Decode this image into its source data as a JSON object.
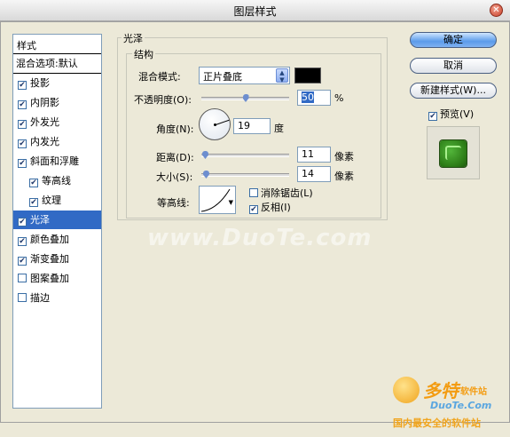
{
  "window": {
    "title": "图层样式",
    "close_glyph": "✕"
  },
  "style_list": {
    "header": "样式",
    "blend_options": "混合选项:默认",
    "items": [
      {
        "label": "投影",
        "checked": true,
        "sub": false
      },
      {
        "label": "内阴影",
        "checked": true,
        "sub": false
      },
      {
        "label": "外发光",
        "checked": true,
        "sub": false
      },
      {
        "label": "内发光",
        "checked": true,
        "sub": false
      },
      {
        "label": "斜面和浮雕",
        "checked": true,
        "sub": false
      },
      {
        "label": "等高线",
        "checked": true,
        "sub": true
      },
      {
        "label": "纹理",
        "checked": true,
        "sub": true
      },
      {
        "label": "光泽",
        "checked": true,
        "sub": false,
        "selected": true
      },
      {
        "label": "颜色叠加",
        "checked": true,
        "sub": false
      },
      {
        "label": "渐变叠加",
        "checked": true,
        "sub": false
      },
      {
        "label": "图案叠加",
        "checked": false,
        "sub": false
      },
      {
        "label": "描边",
        "checked": false,
        "sub": false
      }
    ]
  },
  "panel": {
    "section_title": "光泽",
    "group_title": "结构",
    "blend_mode": {
      "label": "混合模式:",
      "value": "正片叠底",
      "color": "#000000"
    },
    "opacity": {
      "label": "不透明度(O):",
      "value": "50",
      "unit": "%",
      "level": 0.5
    },
    "angle": {
      "label": "角度(N):",
      "value": "19",
      "unit": "度"
    },
    "distance": {
      "label": "距离(D):",
      "value": "11",
      "unit": "像素",
      "level": 0.04
    },
    "size": {
      "label": "大小(S):",
      "value": "14",
      "unit": "像素",
      "level": 0.05
    },
    "contour": {
      "label": "等高线:"
    },
    "anti_alias": {
      "label": "消除锯齿(L)",
      "checked": false
    },
    "invert": {
      "label": "反相(I)",
      "checked": true
    }
  },
  "buttons": {
    "ok": "确定",
    "cancel": "取消",
    "new_style": "新建样式(W)...",
    "preview": {
      "label": "预览(V)",
      "checked": true
    }
  },
  "watermark": "www.DuoTe.com",
  "logo": {
    "brand": "多特",
    "brand_sub": "软件站",
    "url": "DuoTe.Com",
    "slogan": "国内最安全的软件站"
  },
  "colors": {
    "selection": "#316ac5",
    "button_primary": "#5b9bea"
  }
}
